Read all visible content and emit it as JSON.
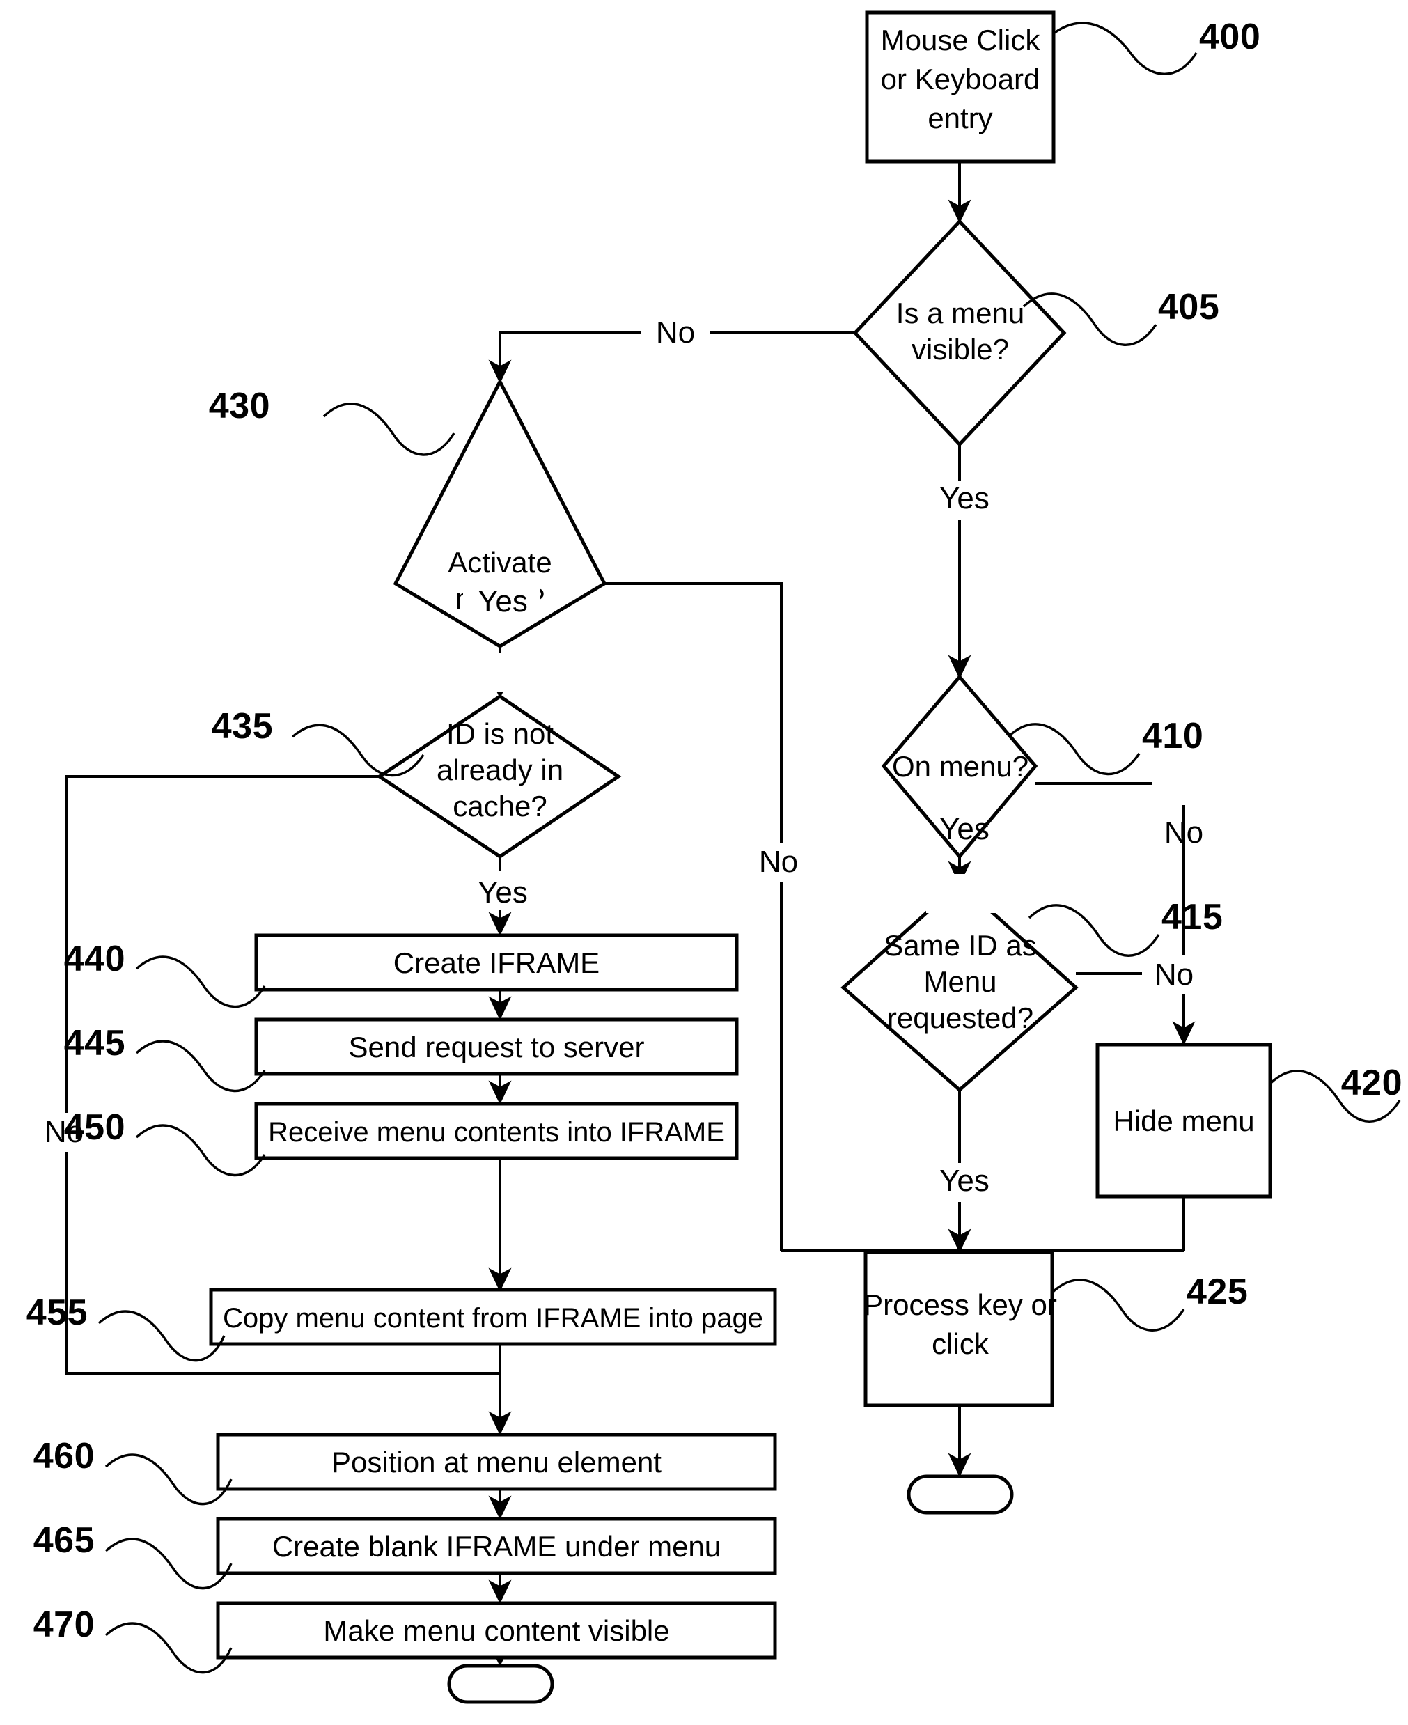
{
  "figure": {
    "type": "flowchart",
    "orientation": "top-to-bottom",
    "nodes": [
      {
        "ref": "400",
        "kind": "process",
        "label": "Mouse Click\nor Keyboard\nentry",
        "line1": "Mouse Click",
        "line2": "or Keyboard",
        "line3": "entry"
      },
      {
        "ref": "405",
        "kind": "decision",
        "label": "Is a menu visible?",
        "line1": "Is a menu",
        "line2": "visible?"
      },
      {
        "ref": "410",
        "kind": "decision",
        "label": "On menu?",
        "line1": "On menu?"
      },
      {
        "ref": "415",
        "kind": "decision",
        "label": "Same ID as Menu requested?",
        "line1": "Same ID as",
        "line2": "Menu",
        "line3": "requested?"
      },
      {
        "ref": "420",
        "kind": "process",
        "label": "Hide menu",
        "line1": "Hide menu"
      },
      {
        "ref": "425",
        "kind": "process",
        "label": "Process key or click",
        "line1": "Process key or",
        "line2": "click"
      },
      {
        "ref": "430",
        "kind": "decision",
        "label": "Activate menu?",
        "line1": "Activate",
        "line2": "menu?"
      },
      {
        "ref": "435",
        "kind": "decision",
        "label": "ID is not already in cache?",
        "line1": "ID is not",
        "line2": "already  in",
        "line3": "cache?"
      },
      {
        "ref": "440",
        "kind": "process",
        "label": "Create  IFRAME",
        "line1": "Create  IFRAME"
      },
      {
        "ref": "445",
        "kind": "process",
        "label": "Send request to server",
        "line1": "Send request to server"
      },
      {
        "ref": "450",
        "kind": "process",
        "label": "Receive  menu contents into IFRAME",
        "line1": "Receive  menu contents into IFRAME"
      },
      {
        "ref": "455",
        "kind": "process",
        "label": "Copy menu content from IFRAME into page",
        "line1": "Copy menu content from IFRAME into page"
      },
      {
        "ref": "460",
        "kind": "process",
        "label": "Position at menu element",
        "line1": "Position at menu element"
      },
      {
        "ref": "465",
        "kind": "process",
        "label": "Create blank IFRAME under menu",
        "line1": "Create blank IFRAME under menu"
      },
      {
        "ref": "470",
        "kind": "process",
        "label": "Make menu content visible",
        "line1": "Make menu content visible"
      },
      {
        "ref": "",
        "kind": "terminator",
        "label": ""
      },
      {
        "ref": "",
        "kind": "terminator",
        "label": ""
      }
    ],
    "edge_labels": {
      "menu_visible_no": "No",
      "menu_visible_yes": "Yes",
      "on_menu_yes": "Yes",
      "on_menu_no": "No",
      "same_id_no": "No",
      "same_id_yes": "Yes",
      "activate_menu_yes": "Yes",
      "activate_menu_no": "No",
      "cache_yes": "Yes",
      "cache_no": "No"
    },
    "reference_numerals": {
      "r400": "400",
      "r405": "405",
      "r410": "410",
      "r415": "415",
      "r420": "420",
      "r425": "425",
      "r430": "430",
      "r435": "435",
      "r440": "440",
      "r445": "445",
      "r450": "450",
      "r455": "455",
      "r460": "460",
      "r465": "465",
      "r470": "470"
    },
    "colors": {
      "ink": "#000000",
      "paper": "#ffffff"
    }
  }
}
